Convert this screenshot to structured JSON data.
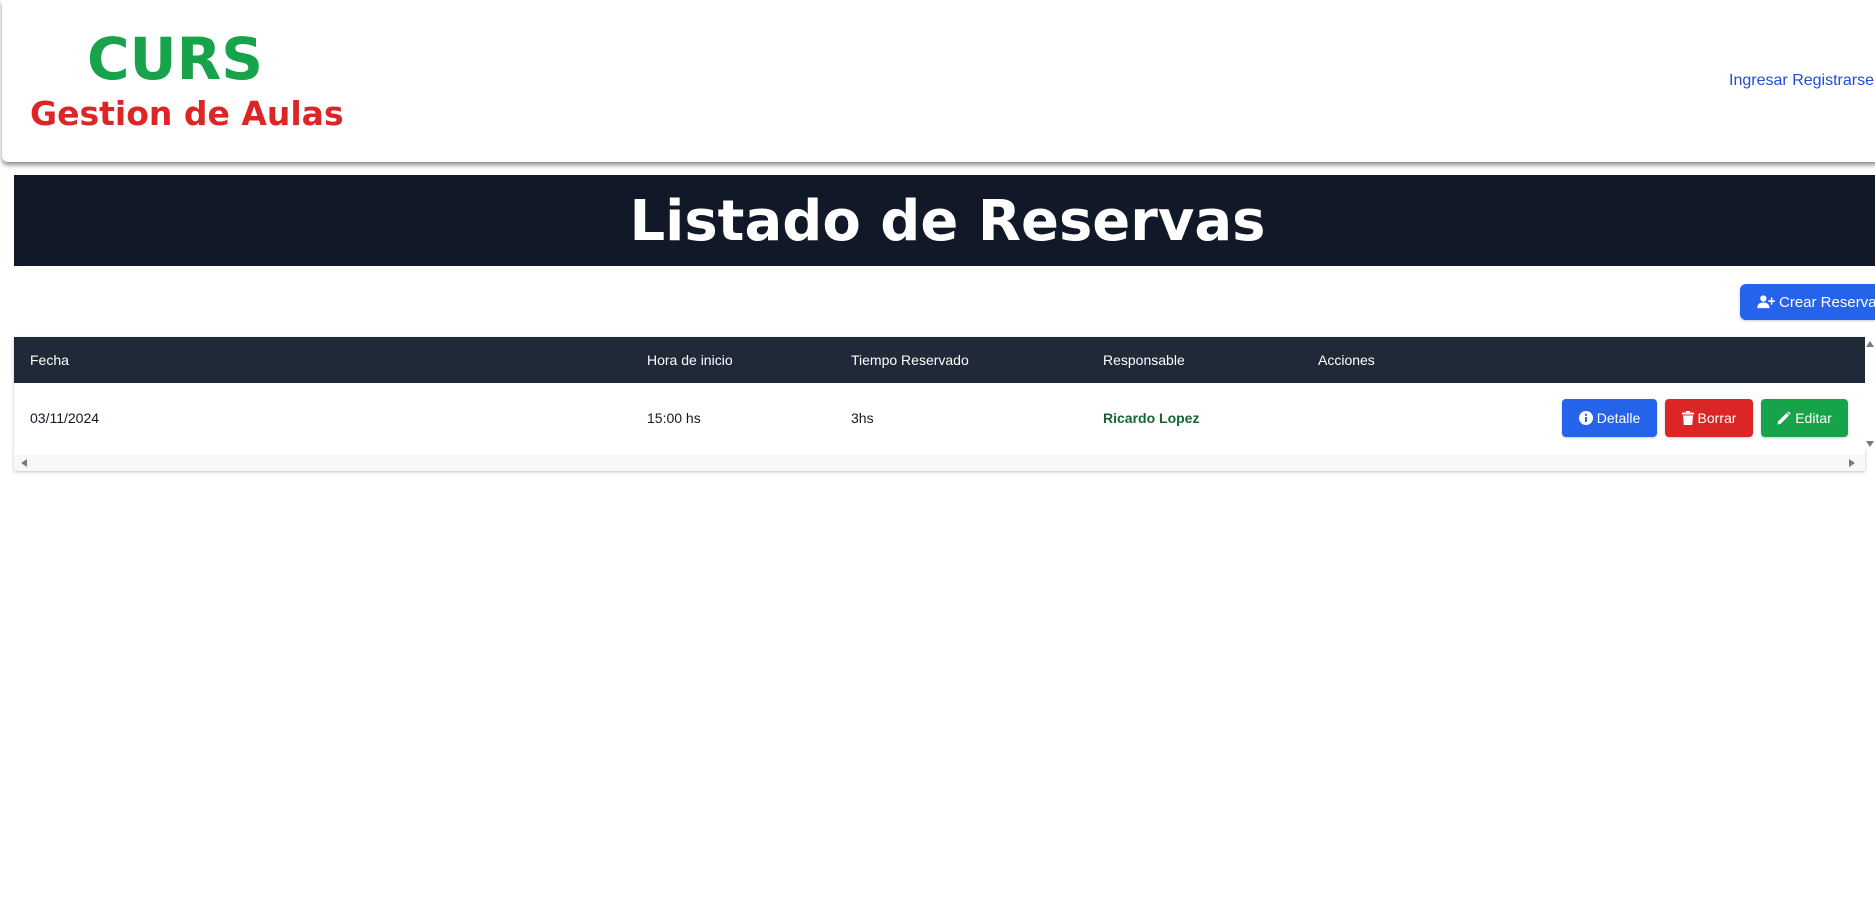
{
  "brand": {
    "title": "CURS",
    "subtitle": "Gestion de Aulas"
  },
  "nav": {
    "login_label": "Ingresar",
    "register_label": "Registrarse"
  },
  "page": {
    "title": "Listado de Reservas",
    "create_label": "Crear Reserva",
    "create_icon": "user-plus-icon"
  },
  "table": {
    "headers": [
      "Fecha",
      "Hora de inicio",
      "Tiempo Reservado",
      "Responsable",
      "Acciones"
    ],
    "rows": [
      {
        "fecha": "03/11/2024",
        "hora": "15:00 hs",
        "tiempo": "3hs",
        "responsable": "Ricardo Lopez"
      }
    ],
    "actions": {
      "detail_label": "Detalle",
      "delete_label": "Borrar",
      "edit_label": "Editar"
    }
  },
  "colors": {
    "brand_green": "#16a34a",
    "brand_red": "#dc2626",
    "header_dark": "#111827",
    "table_header": "#1f2937",
    "primary_blue": "#2563eb",
    "responsable_text": "#166534"
  }
}
